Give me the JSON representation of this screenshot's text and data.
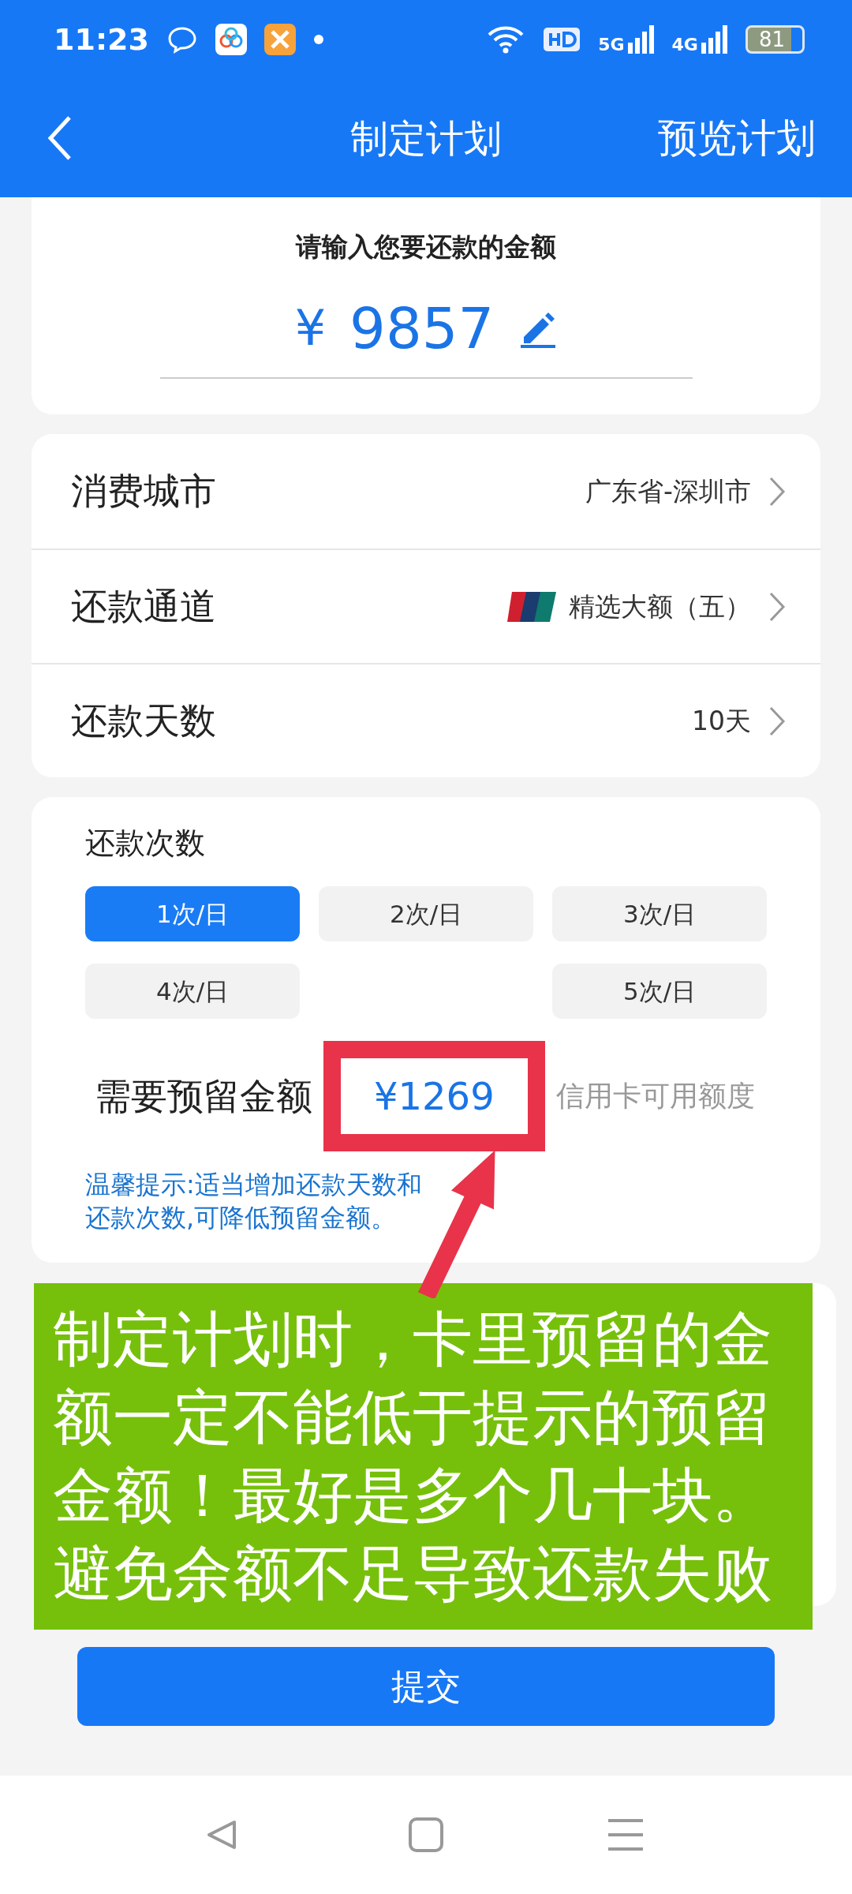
{
  "status_bar": {
    "time": "11:23",
    "network_labels": [
      "5G",
      "4G"
    ],
    "battery": "81"
  },
  "header": {
    "title": "制定计划",
    "action": "预览计划"
  },
  "amount_card": {
    "prompt": "请输入您要还款的金额",
    "currency": "¥",
    "amount": "9857"
  },
  "settings": [
    {
      "label": "消费城市",
      "value": "广东省-深圳市",
      "kind": "plain"
    },
    {
      "label": "还款通道",
      "value": "精选大额（五）",
      "kind": "bank"
    },
    {
      "label": "还款天数",
      "value": "10天",
      "kind": "plain"
    }
  ],
  "frequency": {
    "title": "还款次数",
    "options": [
      {
        "label": "1次/日",
        "selected": true
      },
      {
        "label": "2次/日",
        "selected": false
      },
      {
        "label": "3次/日",
        "selected": false
      },
      {
        "label": "4次/日",
        "selected": false
      },
      {
        "label": "5次/日",
        "selected": false
      }
    ]
  },
  "reserve": {
    "label": "需要预留金额",
    "amount": "¥1269",
    "note": "信用卡可用额度"
  },
  "tip": "温馨提示:适当增加还款天数和还款次数,可降低预留金额。",
  "annotation": {
    "text": "制定计划时，卡里预留的金额一定不能低于提示的预留金额！最好是多个几十块。避免余额不足导致还款失败"
  },
  "submit": "提交"
}
